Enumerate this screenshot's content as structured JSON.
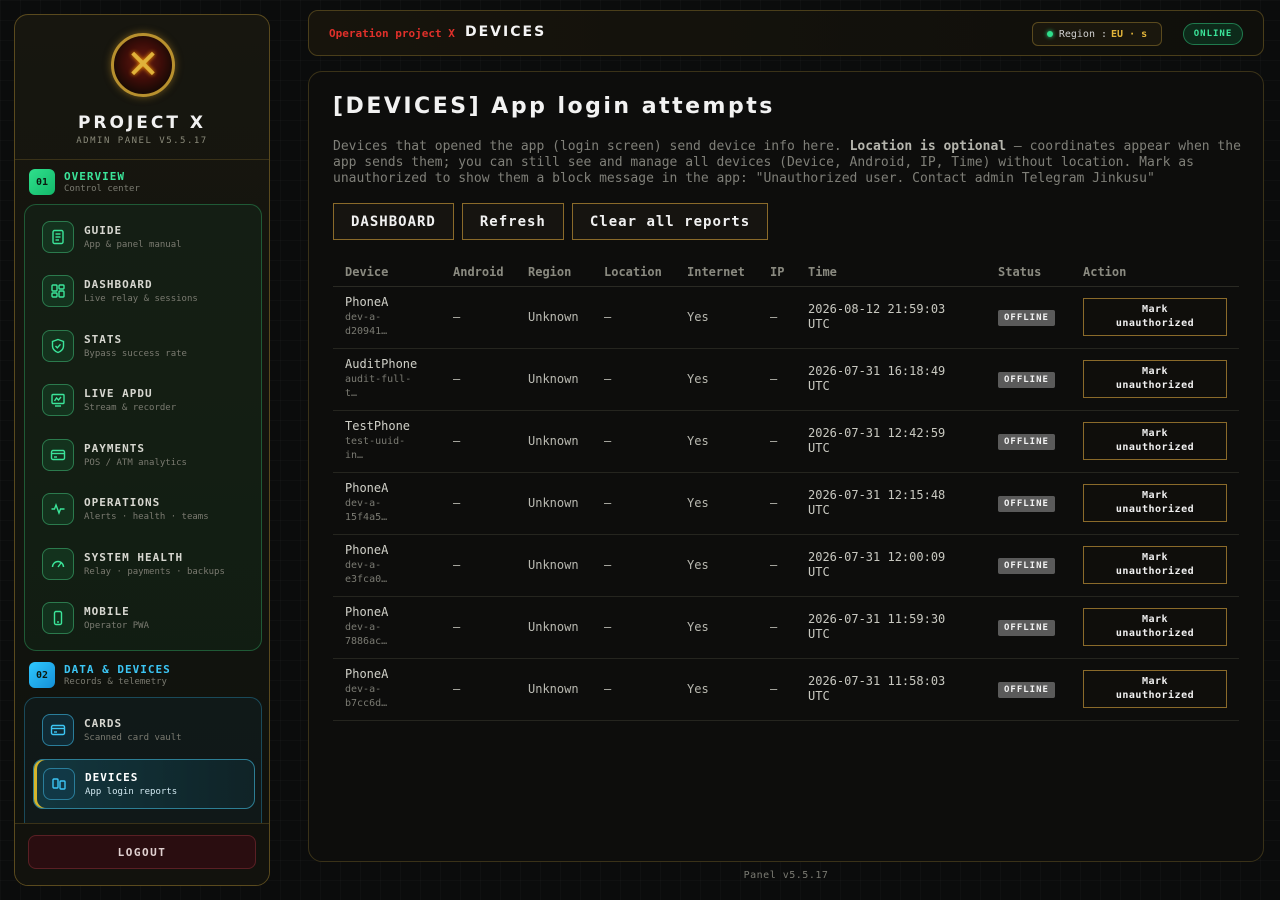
{
  "brand": {
    "title": "PROJECT X",
    "subtitle": "ADMIN PANEL V5.5.17"
  },
  "sidebar": {
    "sections": [
      {
        "badge": "01",
        "title": "OVERVIEW",
        "subtitle": "Control center",
        "color": "#3be59a"
      },
      {
        "badge": "02",
        "title": "DATA & DEVICES",
        "subtitle": "Records & telemetry",
        "color": "#3cc6f5"
      }
    ],
    "items": [
      {
        "label": "GUIDE",
        "sub": "App & panel manual",
        "icon": "document-icon"
      },
      {
        "label": "DASHBOARD",
        "sub": "Live relay & sessions",
        "icon": "dashboard-icon"
      },
      {
        "label": "STATS",
        "sub": "Bypass success rate",
        "icon": "shield-icon"
      },
      {
        "label": "LIVE APDU",
        "sub": "Stream & recorder",
        "icon": "monitor-icon"
      },
      {
        "label": "PAYMENTS",
        "sub": "POS / ATM analytics",
        "icon": "card-icon"
      },
      {
        "label": "OPERATIONS",
        "sub": "Alerts · health · teams",
        "icon": "pulse-icon"
      },
      {
        "label": "SYSTEM HEALTH",
        "sub": "Relay · payments · backups",
        "icon": "gauge-icon"
      },
      {
        "label": "MOBILE",
        "sub": "Operator PWA",
        "icon": "phone-icon"
      },
      {
        "label": "CARDS",
        "sub": "Scanned card vault",
        "icon": "card-icon"
      },
      {
        "label": "DEVICES",
        "sub": "App login reports",
        "icon": "devices-icon"
      }
    ],
    "logout_label": "LOGOUT"
  },
  "topbar": {
    "context": "Operation project X",
    "title": "DEVICES",
    "region_label": "Region :",
    "region_value": "EU · s",
    "status": "ONLINE"
  },
  "main": {
    "title": "[DEVICES] App login attempts",
    "description_pre": "Devices that opened the app (login screen) send device info here. ",
    "description_bold": "Location is optional",
    "description_post": " – coordinates appear when the app sends them; you can still see and manage all devices (Device, Android, IP, Time) without location. Mark as unauthorized to show them a block message in the app: \"Unauthorized user. Contact admin Telegram Jinkusu\"",
    "buttons": {
      "dashboard": "DASHBOARD",
      "refresh": "Refresh",
      "clear": "Clear all reports"
    },
    "columns": [
      "Device",
      "Android",
      "Region",
      "Location",
      "Internet",
      "IP",
      "Time",
      "Status",
      "Action"
    ],
    "action_line1": "Mark",
    "action_line2": "unauthorized",
    "rows": [
      {
        "device": "PhoneA",
        "id_line1": "dev-a-",
        "id_line2": "d20941…",
        "android": "—",
        "region": "Unknown",
        "location": "—",
        "internet": "Yes",
        "ip": "—",
        "time_line1": "2026-08-12 21:59:03",
        "time_line2": "UTC",
        "status": "OFFLINE"
      },
      {
        "device": "AuditPhone",
        "id_line1": "audit-full-",
        "id_line2": "t…",
        "android": "—",
        "region": "Unknown",
        "location": "—",
        "internet": "Yes",
        "ip": "—",
        "time_line1": "2026-07-31 16:18:49",
        "time_line2": "UTC",
        "status": "OFFLINE"
      },
      {
        "device": "TestPhone",
        "id_line1": "test-uuid-",
        "id_line2": "in…",
        "android": "—",
        "region": "Unknown",
        "location": "—",
        "internet": "Yes",
        "ip": "—",
        "time_line1": "2026-07-31 12:42:59",
        "time_line2": "UTC",
        "status": "OFFLINE"
      },
      {
        "device": "PhoneA",
        "id_line1": "dev-a-",
        "id_line2": "15f4a5…",
        "android": "—",
        "region": "Unknown",
        "location": "—",
        "internet": "Yes",
        "ip": "—",
        "time_line1": "2026-07-31 12:15:48",
        "time_line2": "UTC",
        "status": "OFFLINE"
      },
      {
        "device": "PhoneA",
        "id_line1": "dev-a-",
        "id_line2": "e3fca0…",
        "android": "—",
        "region": "Unknown",
        "location": "—",
        "internet": "Yes",
        "ip": "—",
        "time_line1": "2026-07-31 12:00:09",
        "time_line2": "UTC",
        "status": "OFFLINE"
      },
      {
        "device": "PhoneA",
        "id_line1": "dev-a-",
        "id_line2": "7886ac…",
        "android": "—",
        "region": "Unknown",
        "location": "—",
        "internet": "Yes",
        "ip": "—",
        "time_line1": "2026-07-31 11:59:30",
        "time_line2": "UTC",
        "status": "OFFLINE"
      },
      {
        "device": "PhoneA",
        "id_line1": "dev-a-",
        "id_line2": "b7cc6d…",
        "android": "—",
        "region": "Unknown",
        "location": "—",
        "internet": "Yes",
        "ip": "—",
        "time_line1": "2026-07-31 11:58:03",
        "time_line2": "UTC",
        "status": "OFFLINE"
      }
    ]
  },
  "footer": "Panel v5.5.17",
  "colors": {
    "accent_gold": "#8a6a2a",
    "green": "#3be59a",
    "cyan": "#3cc6f5",
    "alert_red": "#e0302a"
  }
}
